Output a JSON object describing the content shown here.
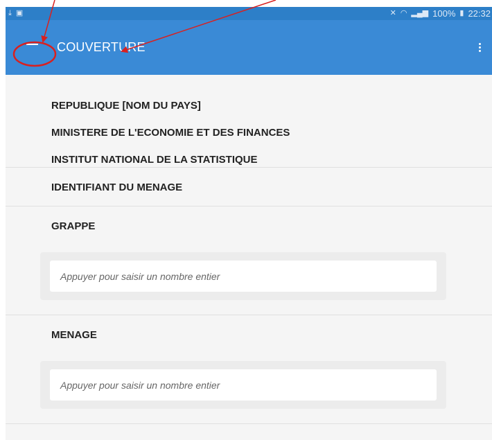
{
  "status_bar": {
    "left_icons": [
      "download-icon",
      "image-icon"
    ],
    "battery": "100%",
    "time": "22:32"
  },
  "app_bar": {
    "title": "COUVERTURE"
  },
  "cover": {
    "line1": "REPUBLIQUE [NOM DU PAYS]",
    "line2": "MINISTERE DE L'ECONOMIE ET DES FINANCES",
    "line3": "INSTITUT NATIONAL DE LA STATISTIQUE"
  },
  "id_section": {
    "label": "IDENTIFIANT DU MENAGE"
  },
  "grappe": {
    "label": "GRAPPE",
    "placeholder": "Appuyer pour saisir un nombre entier"
  },
  "menage": {
    "label": "MENAGE",
    "placeholder": "Appuyer pour saisir un nombre entier"
  },
  "colors": {
    "app_bar": "#3a8ad6",
    "status_bar": "#2d7fc8",
    "annotation": "#d9201f"
  }
}
